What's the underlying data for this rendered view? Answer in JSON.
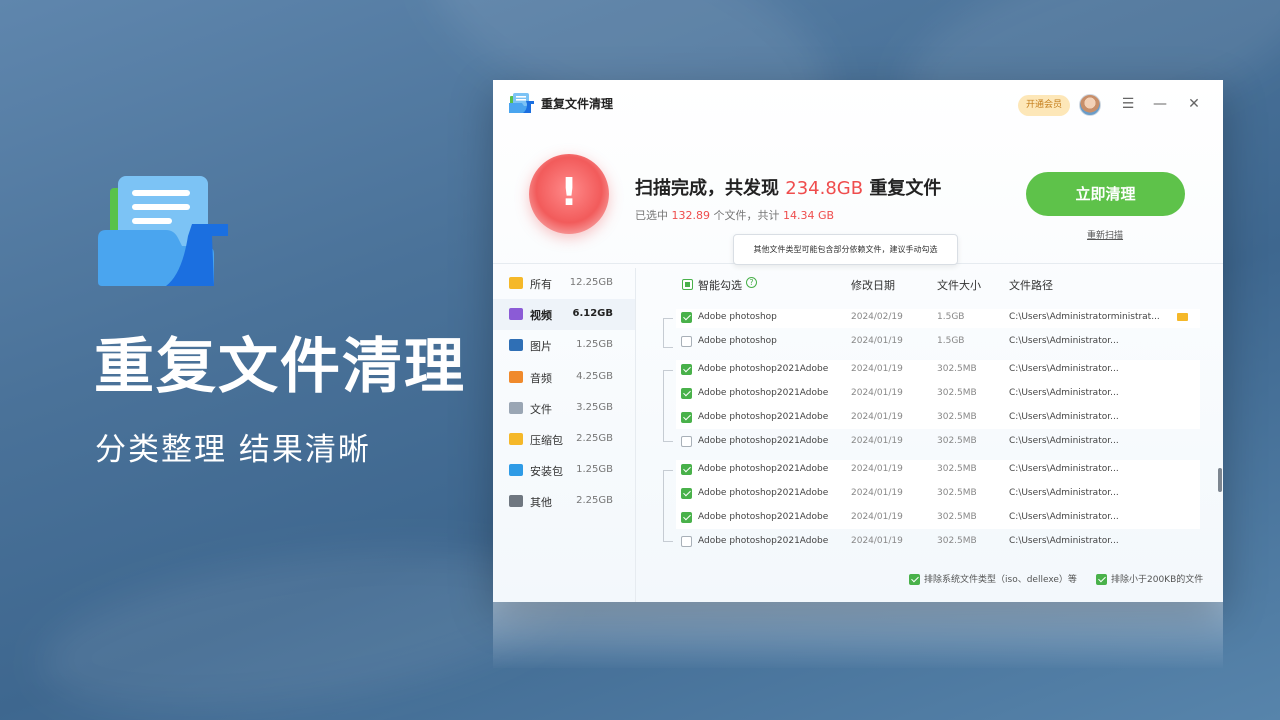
{
  "hero": {
    "title": "重复文件清理",
    "subtitle": "分类整理 结果清晰"
  },
  "window": {
    "app_title": "重复文件清理",
    "vip_label": "开通会员",
    "controls": {
      "menu": "☰",
      "minimize": "—",
      "close": "✕"
    }
  },
  "scan": {
    "title_prefix": "扫描完成，共发现 ",
    "title_size": "234.8GB",
    "title_suffix": " 重复文件",
    "selected_prefix": "已选中 ",
    "selected_count": "132.89",
    "selected_mid": " 个文件，共计 ",
    "selected_size": "14.34 GB",
    "clean_button": "立即清理",
    "rescan_link": "重新扫描",
    "tooltip": "其他文件类型可能包含部分依赖文件，建议手动勾选"
  },
  "sidebar": {
    "items": [
      {
        "label": "所有",
        "size": "12.25GB",
        "color": "#f5b829",
        "active": false
      },
      {
        "label": "视频",
        "size": "6.12GB",
        "color": "#8b5bd6",
        "active": true
      },
      {
        "label": "图片",
        "size": "1.25GB",
        "color": "#2f6fb5",
        "active": false
      },
      {
        "label": "音频",
        "size": "4.25GB",
        "color": "#f08a2c",
        "active": false
      },
      {
        "label": "文件",
        "size": "3.25GB",
        "color": "#9aa6b4",
        "active": false
      },
      {
        "label": "压缩包",
        "size": "2.25GB",
        "color": "#f5b829",
        "active": false
      },
      {
        "label": "安装包",
        "size": "1.25GB",
        "color": "#2e9be6",
        "active": false
      },
      {
        "label": "其他",
        "size": "2.25GB",
        "color": "#6f7780",
        "active": false
      }
    ]
  },
  "table": {
    "headers": {
      "smart_select": "智能勾选",
      "date": "修改日期",
      "size": "文件大小",
      "path": "文件路径"
    },
    "rows": [
      {
        "checked": true,
        "name": "Adobe photoshop",
        "date": "2024/02/19",
        "size": "1.5GB",
        "path": "C:\\Users\\Administratorministrat...",
        "folder": true
      },
      {
        "checked": false,
        "name": "Adobe photoshop",
        "date": "2024/01/19",
        "size": "1.5GB",
        "path": "C:\\Users\\Administrator...",
        "folder": false
      },
      {
        "checked": true,
        "name": "Adobe photoshop2021Adobe",
        "date": "2024/01/19",
        "size": "302.5MB",
        "path": "C:\\Users\\Administrator...",
        "folder": false
      },
      {
        "checked": true,
        "name": "Adobe photoshop2021Adobe",
        "date": "2024/01/19",
        "size": "302.5MB",
        "path": "C:\\Users\\Administrator...",
        "folder": false
      },
      {
        "checked": true,
        "name": "Adobe photoshop2021Adobe",
        "date": "2024/01/19",
        "size": "302.5MB",
        "path": "C:\\Users\\Administrator...",
        "folder": false
      },
      {
        "checked": false,
        "name": "Adobe photoshop2021Adobe",
        "date": "2024/01/19",
        "size": "302.5MB",
        "path": "C:\\Users\\Administrator...",
        "folder": false
      },
      {
        "checked": true,
        "name": "Adobe photoshop2021Adobe",
        "date": "2024/01/19",
        "size": "302.5MB",
        "path": "C:\\Users\\Administrator...",
        "folder": false
      },
      {
        "checked": true,
        "name": "Adobe photoshop2021Adobe",
        "date": "2024/01/19",
        "size": "302.5MB",
        "path": "C:\\Users\\Administrator...",
        "folder": false
      },
      {
        "checked": true,
        "name": "Adobe photoshop2021Adobe",
        "date": "2024/01/19",
        "size": "302.5MB",
        "path": "C:\\Users\\Administrator...",
        "folder": false
      },
      {
        "checked": false,
        "name": "Adobe photoshop2021Adobe",
        "date": "2024/01/19",
        "size": "302.5MB",
        "path": "C:\\Users\\Administrator...",
        "folder": false
      }
    ]
  },
  "footer": {
    "exclude_system": "排除系统文件类型（iso、dellexe）等",
    "exclude_small": "排除小于200KB的文件"
  }
}
